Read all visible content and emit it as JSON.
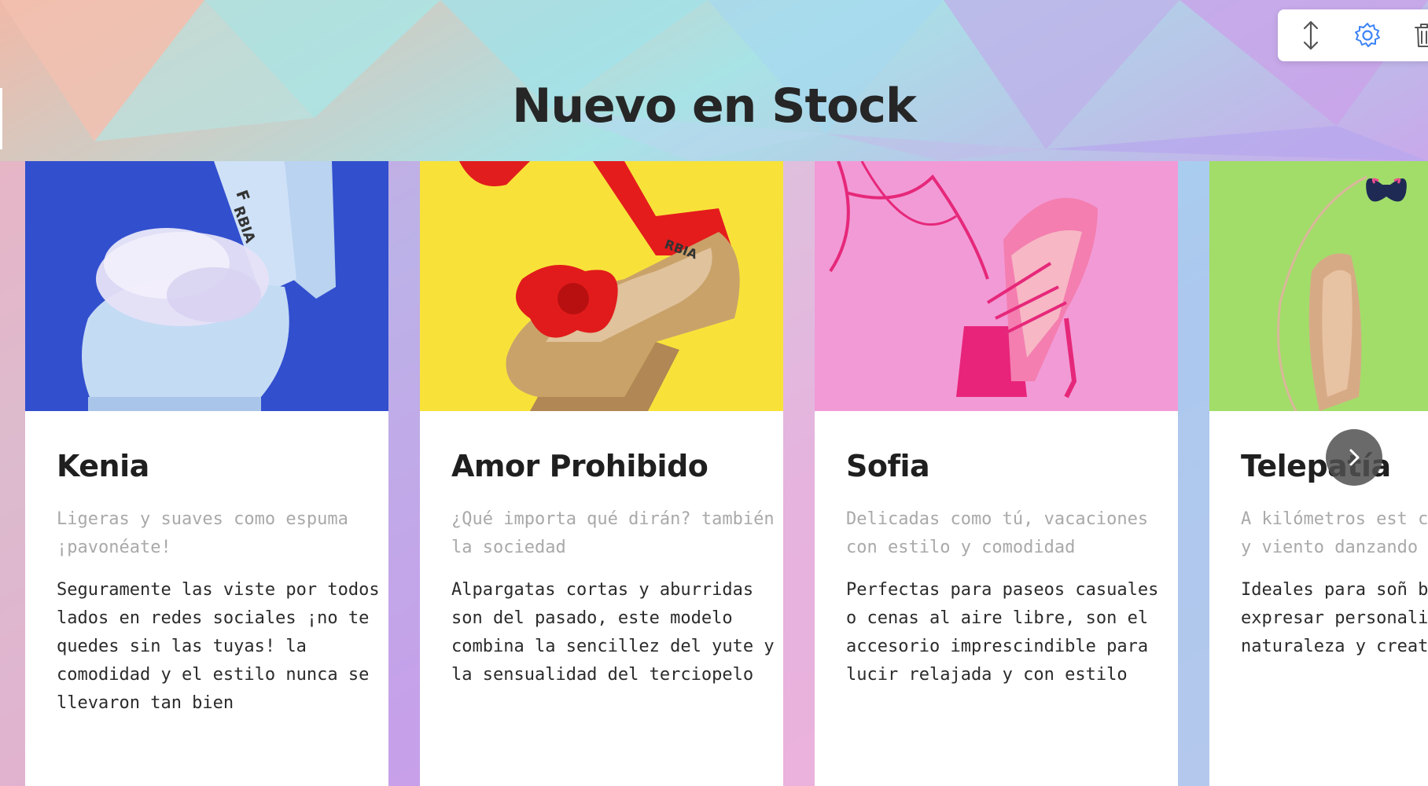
{
  "section": {
    "title": "Nuevo en Stock"
  },
  "toolbar": {
    "icons": [
      "move-vertical-icon",
      "gear-icon",
      "trash-icon"
    ]
  },
  "colors": {
    "title": "#262626",
    "subtitle": "#a9a9a9",
    "text": "#2b2b2b",
    "gear_accent": "#3b82f6"
  },
  "products": [
    {
      "name": "Kenia",
      "subtitle": "Ligeras y suaves como espuma ¡pavonéate!",
      "description": "Seguramente las viste por todos lados en redes sociales ¡no te quedes sin las tuyas! la comodidad y el estilo nunca se llevaron tan bien",
      "photo_bg": "#2f4bc9"
    },
    {
      "name": "Amor Prohibido",
      "subtitle": "¿Qué importa qué dirán? también la sociedad",
      "description": "Alpargatas cortas y aburridas son del pasado, este modelo combina la sencillez del yute y la sensualidad del terciopelo",
      "photo_bg": "#f8e23a"
    },
    {
      "name": "Sofia",
      "subtitle": "Delicadas como tú, vacaciones con estilo y comodidad",
      "description": "Perfectas para paseos casuales o cenas al aire libre, son el accesorio imprescindible para lucir relajada y con estilo",
      "photo_bg": "#f29ad6"
    },
    {
      "name": "Telepatía",
      "subtitle": "A kilómetros est conectando... y viento danzando",
      "description": "Ideales para soñ buscan expresar personalidad con de naturaleza y creatividad",
      "photo_bg": "#a2dd6a"
    }
  ],
  "carousel": {
    "next_icon": "chevron-right-icon"
  }
}
